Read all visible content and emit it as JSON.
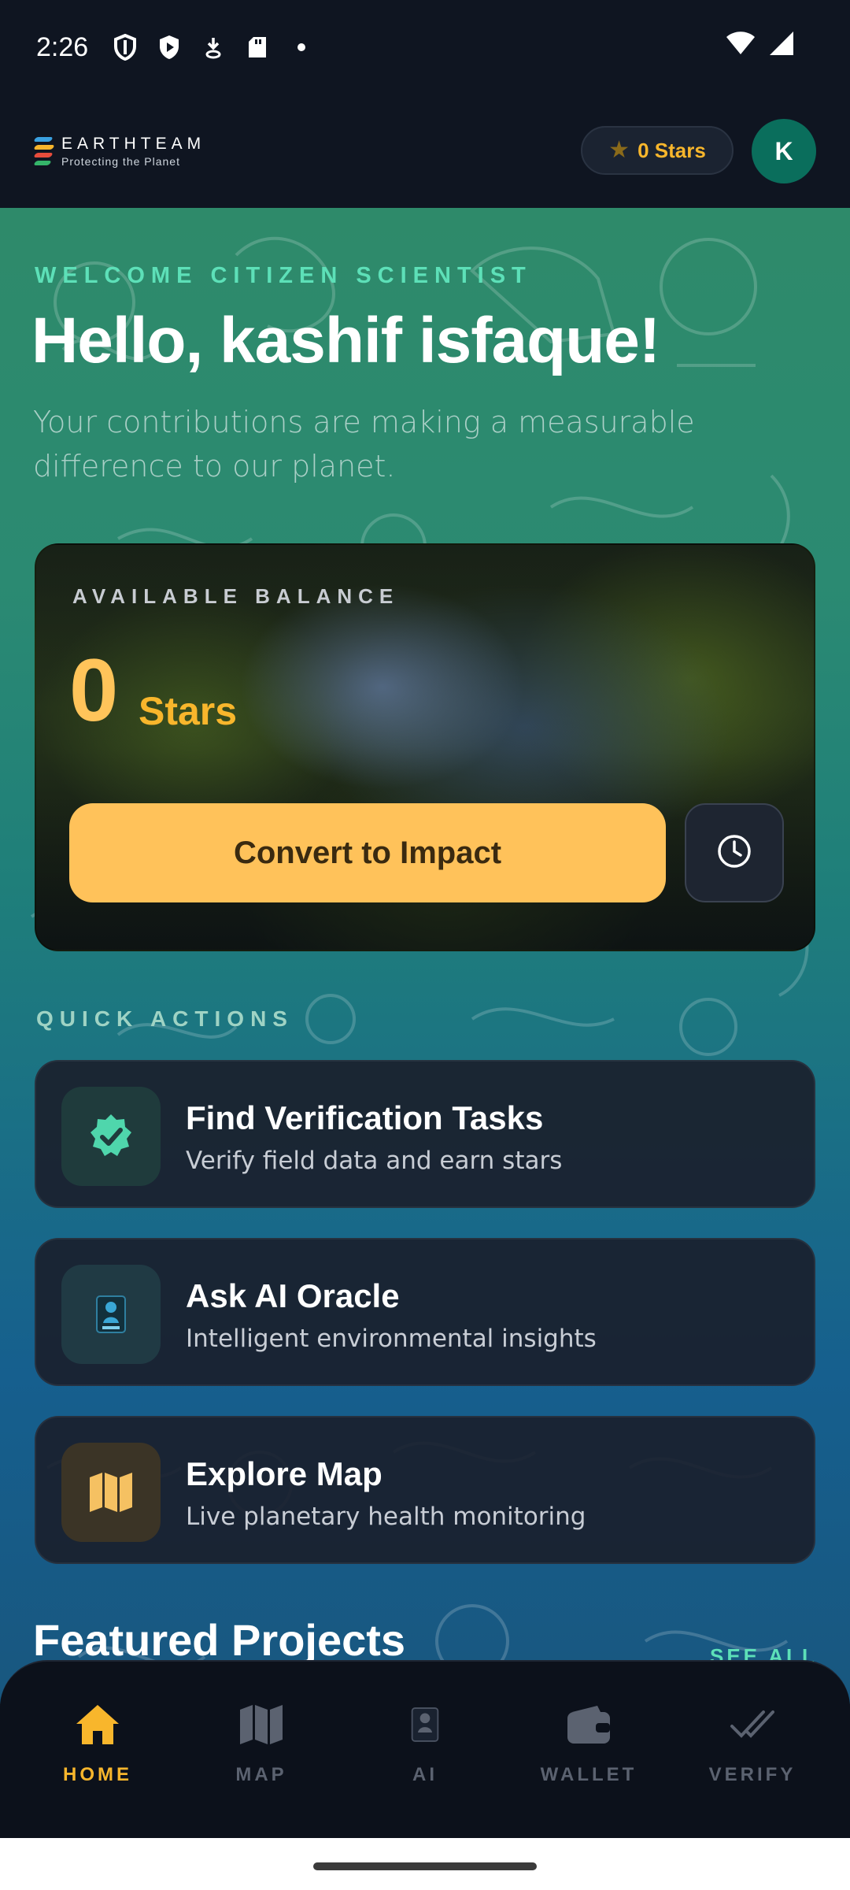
{
  "status_bar": {
    "time": "2:26"
  },
  "app_bar": {
    "logo_title": "EARTHTEAM",
    "logo_subtitle": "Protecting the Planet",
    "stars_pill": "0 Stars",
    "avatar_initial": "K"
  },
  "hero": {
    "kicker": "WELCOME CITIZEN SCIENTIST",
    "greeting": "Hello, kashif isfaque!",
    "subtitle": "Your contributions are making a measurable difference to our planet."
  },
  "balance": {
    "label": "AVAILABLE BALANCE",
    "amount": "0",
    "unit": "Stars",
    "convert_button": "Convert to Impact"
  },
  "quick_actions": {
    "label": "QUICK ACTIONS",
    "items": [
      {
        "title": "Find Verification Tasks",
        "description": "Verify field data and earn stars",
        "icon": "verified-badge-icon"
      },
      {
        "title": "Ask AI Oracle",
        "description": "Intelligent environmental insights",
        "icon": "ai-oracle-icon"
      },
      {
        "title": "Explore Map",
        "description": "Live planetary health monitoring",
        "icon": "map-icon"
      }
    ]
  },
  "featured": {
    "title": "Featured Projects",
    "see_all": "SEE ALL"
  },
  "bottom_nav": {
    "items": [
      {
        "label": "HOME",
        "icon": "home-icon",
        "active": true
      },
      {
        "label": "MAP",
        "icon": "map-icon",
        "active": false
      },
      {
        "label": "AI",
        "icon": "ai-icon",
        "active": false
      },
      {
        "label": "WALLET",
        "icon": "wallet-icon",
        "active": false
      },
      {
        "label": "VERIFY",
        "icon": "verify-check-icon",
        "active": false
      }
    ]
  },
  "colors": {
    "accent_gold": "#f8b62c",
    "accent_mint": "#5de0b8",
    "avatar_bg": "#0a6e5c",
    "nav_bg": "#0c111b"
  }
}
